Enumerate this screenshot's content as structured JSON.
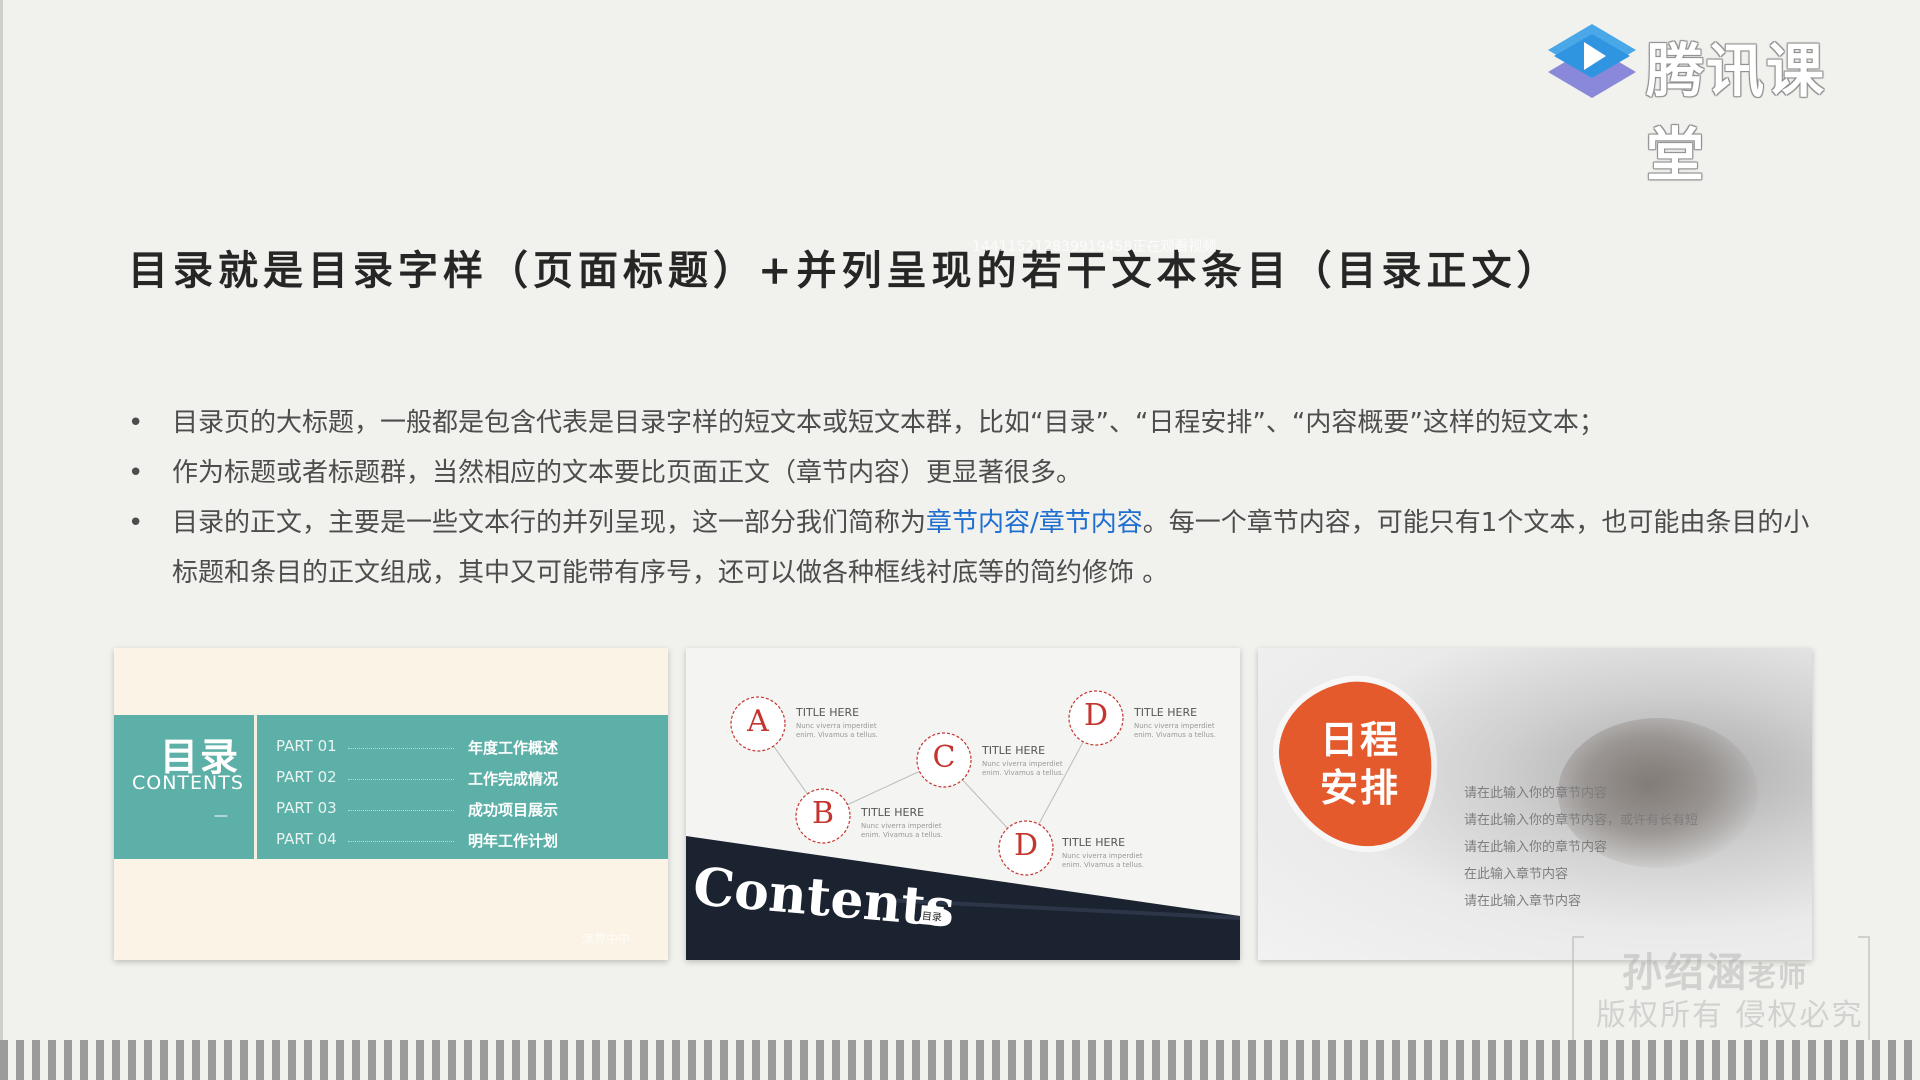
{
  "brand": {
    "name": "腾讯课堂",
    "icon": "tencent-classroom-play-icon"
  },
  "watermark_id": "144115212839919458正在观看视频",
  "title": "目录就是目录字样（页面标题）+并列呈现的若干文本条目（目录正文）",
  "bullets": [
    {
      "text": "目录页的大标题，一般都是包含代表是目录字样的短文本或短文本群，比如“目录”、“日程安排”、“内容概要”这样的短文本；"
    },
    {
      "text": "作为标题或者标题群，当然相应的文本要比页面正文（章节内容）更显著很多。"
    },
    {
      "pre": "目录的正文，主要是一些文本行的并列呈现，这一部分我们简称为",
      "highlight": "章节内容/章节内容",
      "post": "。每一个章节内容，可能只有1个文本，也可能由条目的小标题和条目的正文组成，其中又可能带有序号，还可以做各种框线衬底等的简约修饰 。"
    }
  ],
  "bullet_symbol": "•",
  "card1": {
    "title_zh": "目录",
    "title_en": "CONTENTS",
    "dash": "—",
    "rows": [
      {
        "part": "PART  01",
        "item": "年度工作概述"
      },
      {
        "part": "PART  02",
        "item": "工作完成情况"
      },
      {
        "part": "PART  03",
        "item": "成功项目展示"
      },
      {
        "part": "PART  04",
        "item": "明年工作计划"
      }
    ],
    "mark": "演界中中"
  },
  "card2": {
    "nodes": [
      {
        "letter": "A",
        "label": "TITLE HERE",
        "sub": "Nunc viverra imperdiet enim. Vivamus a tellus."
      },
      {
        "letter": "B",
        "label": "TITLE HERE",
        "sub": "Nunc viverra imperdiet enim. Vivamus a tellus."
      },
      {
        "letter": "C",
        "label": "TITLE HERE",
        "sub": "Nunc viverra imperdiet enim. Vivamus a tellus."
      },
      {
        "letter": "D",
        "label": "TITLE HERE",
        "sub": "Nunc viverra imperdiet enim. Vivamus a tellus."
      },
      {
        "letter": "D",
        "label": "TITLE HERE",
        "sub": "Nunc viverra imperdiet enim. Vivamus a tellus."
      }
    ],
    "contents": "Contents",
    "tag": "目录"
  },
  "card3": {
    "title_line1": "日程",
    "title_line2": "安排",
    "lines": [
      "请在此输入你的章节内容",
      "请在此输入你的章节内容，或许有长有短",
      "请在此输入你的章节内容",
      "在此输入章节内容",
      "请在此输入章节内容"
    ]
  },
  "teacher": {
    "name": "孙绍涵",
    "title": "老师",
    "copyright": "版权所有 侵权必究"
  },
  "colors": {
    "teal": "#5db0a8",
    "red": "#c3352e",
    "orange": "#e45a2c",
    "link": "#1f6fd0",
    "navy": "#1b2230"
  }
}
